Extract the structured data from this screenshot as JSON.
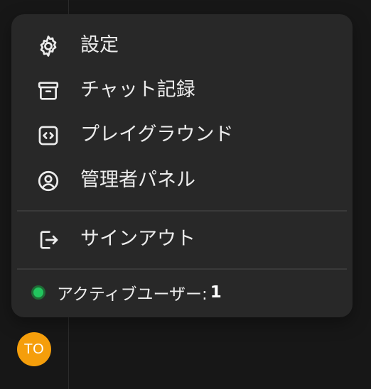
{
  "menu": {
    "items": [
      {
        "label": "設定",
        "icon": "gear-icon"
      },
      {
        "label": "チャット記録",
        "icon": "archive-icon"
      },
      {
        "label": "プレイグラウンド",
        "icon": "code-icon"
      },
      {
        "label": "管理者パネル",
        "icon": "user-circle-icon"
      }
    ],
    "signout": {
      "label": "サインアウト",
      "icon": "sign-out-icon"
    },
    "active_users": {
      "label": "アクティブユーザー:",
      "count": "1",
      "status_color": "#22c55e"
    }
  },
  "user": {
    "initials": "TO",
    "avatar_color": "#f59e0b"
  },
  "colors": {
    "background": "#171717",
    "menu_background": "#282828",
    "text": "#ececec"
  }
}
